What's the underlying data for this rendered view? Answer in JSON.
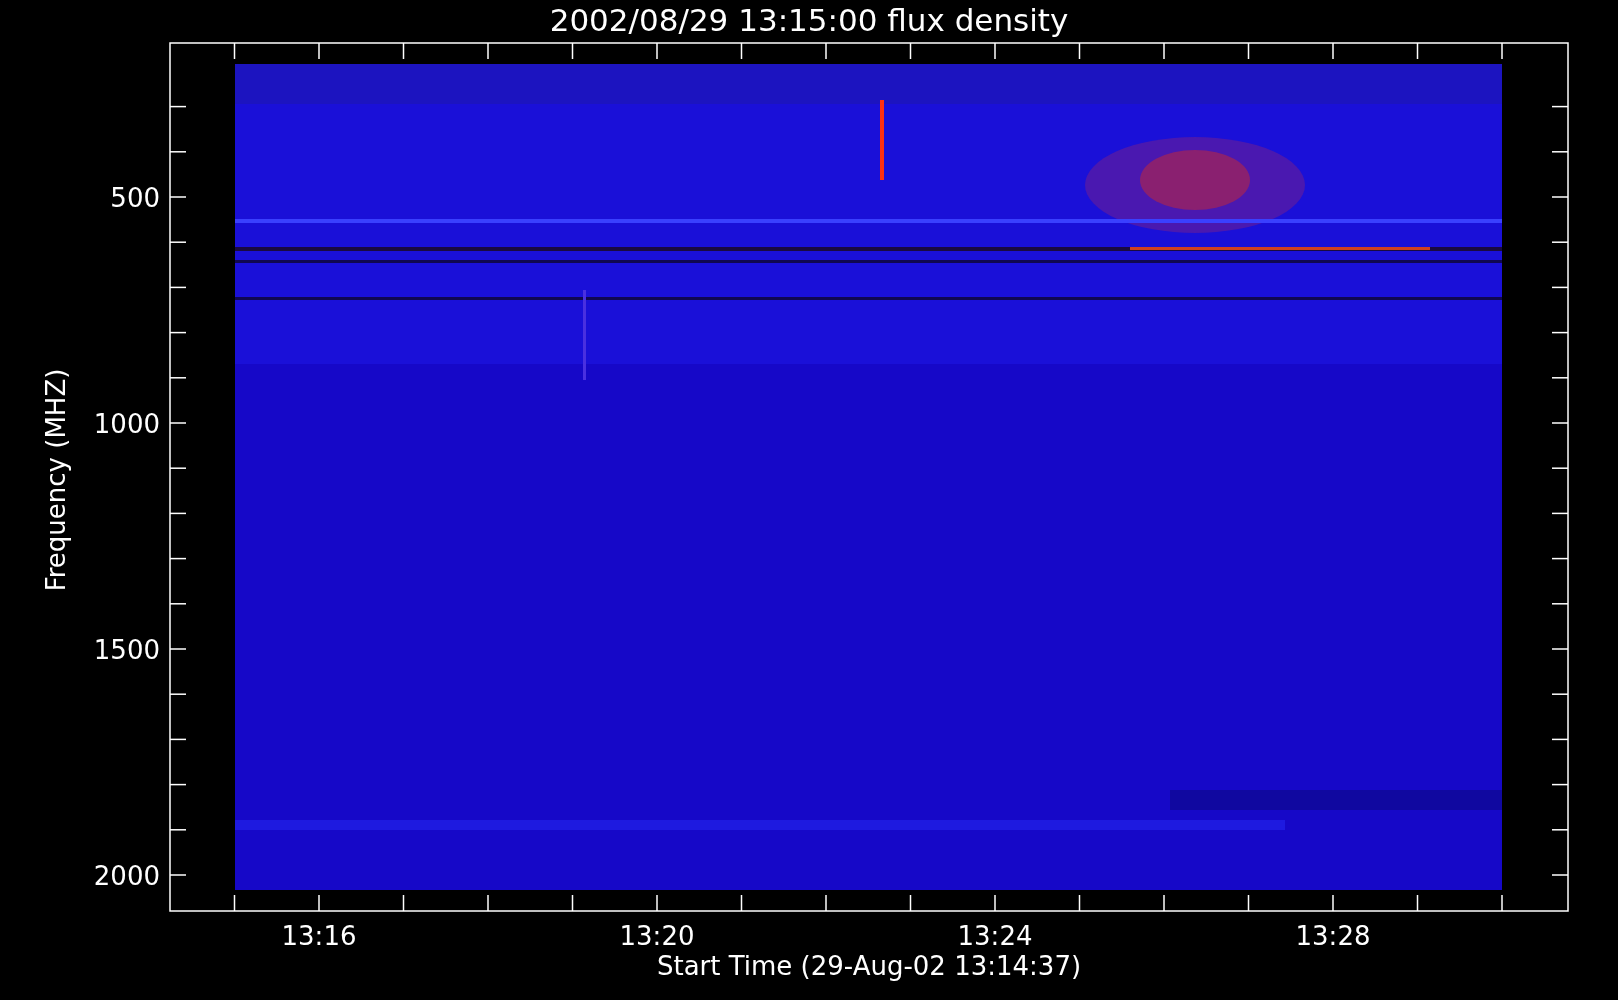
{
  "plot": {
    "title": "2002/08/29 13:15:00 flux density",
    "ylabel": "Frequency (MHZ)",
    "xlabel": "Start Time (29-Aug-02 13:14:37)",
    "yticks": [
      {
        "label": "500"
      },
      {
        "label": "1000"
      },
      {
        "label": "1500"
      },
      {
        "label": "2000"
      }
    ],
    "xticks": [
      {
        "label": "13:16"
      },
      {
        "label": "13:20"
      },
      {
        "label": "13:24"
      },
      {
        "label": "13:28"
      }
    ]
  }
}
